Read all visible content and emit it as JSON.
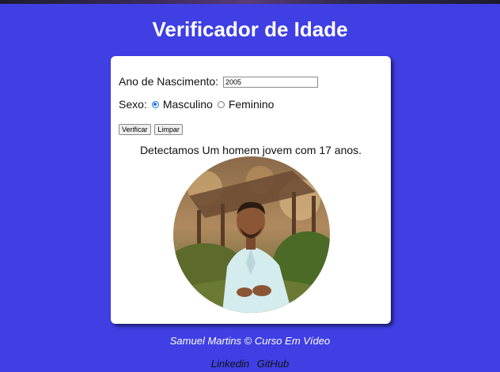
{
  "header": {
    "title": "Verificador de Idade"
  },
  "form": {
    "ano_label": "Ano de Nascimento:",
    "ano_value": "2005",
    "sexo_label": "Sexo:",
    "options": [
      {
        "label": "Masculino",
        "checked": true
      },
      {
        "label": "Feminino",
        "checked": false
      }
    ],
    "buttons": {
      "verificar": "Verificar",
      "limpar": "Limpar"
    }
  },
  "result": {
    "text": "Detectamos Um homem jovem com 17 anos."
  },
  "footer": {
    "credit": "Samuel Martins © Curso Em Vídeo",
    "links": [
      "Linkedin",
      "GitHub"
    ]
  }
}
